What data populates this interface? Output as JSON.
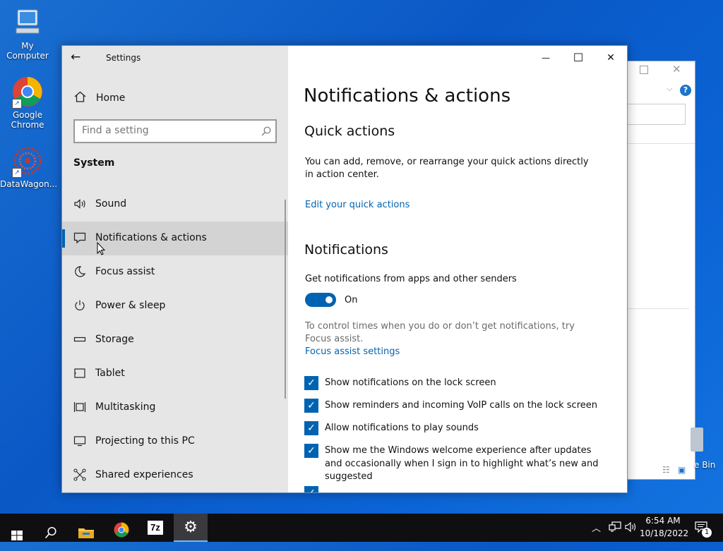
{
  "desktop": {
    "icons": [
      {
        "name": "my-computer",
        "label": "My Computer"
      },
      {
        "name": "google-chrome",
        "label": "Google Chrome"
      },
      {
        "name": "datawagon",
        "label": "DataWagon..."
      }
    ],
    "recycle_label": "e Bin"
  },
  "window": {
    "title": "Settings",
    "minimize": "—",
    "maximize": "☐",
    "close": "✕"
  },
  "sidebar": {
    "home": "Home",
    "search_placeholder": "Find a setting",
    "section": "System",
    "items": [
      {
        "label": "Sound",
        "icon": "speaker-icon",
        "selected": false
      },
      {
        "label": "Notifications & actions",
        "icon": "notification-icon",
        "selected": true
      },
      {
        "label": "Focus assist",
        "icon": "moon-icon",
        "selected": false
      },
      {
        "label": "Power & sleep",
        "icon": "power-icon",
        "selected": false
      },
      {
        "label": "Storage",
        "icon": "storage-icon",
        "selected": false
      },
      {
        "label": "Tablet",
        "icon": "tablet-icon",
        "selected": false
      },
      {
        "label": "Multitasking",
        "icon": "multitasking-icon",
        "selected": false
      },
      {
        "label": "Projecting to this PC",
        "icon": "projector-icon",
        "selected": false
      },
      {
        "label": "Shared experiences",
        "icon": "shared-icon",
        "selected": false
      }
    ]
  },
  "main": {
    "title": "Notifications & actions",
    "quick_actions": {
      "heading": "Quick actions",
      "desc": "You can add, remove, or rearrange your quick actions directly in action center.",
      "link": "Edit your quick actions"
    },
    "notifications": {
      "heading": "Notifications",
      "toggle_label": "Get notifications from apps and other senders",
      "toggle_state": "On",
      "hint": "To control times when you do or don’t get notifications, try Focus assist.",
      "link": "Focus assist settings",
      "checkboxes": [
        {
          "label": "Show notifications on the lock screen",
          "checked": true
        },
        {
          "label": "Show reminders and incoming VoIP calls on the lock screen",
          "checked": true
        },
        {
          "label": "Allow notifications to play sounds",
          "checked": true
        },
        {
          "label": "Show me the Windows welcome experience after updates and occasionally when I sign in to highlight what’s new and suggested",
          "checked": true
        }
      ]
    }
  },
  "taskbar": {
    "time": "6:54 AM",
    "date": "10/18/2022",
    "notification_count": "1",
    "sevenzip": "7z"
  },
  "colors": {
    "accent": "#0063b1",
    "taskbar": "#0f0f12",
    "sidebar": "#e6e6e6"
  }
}
